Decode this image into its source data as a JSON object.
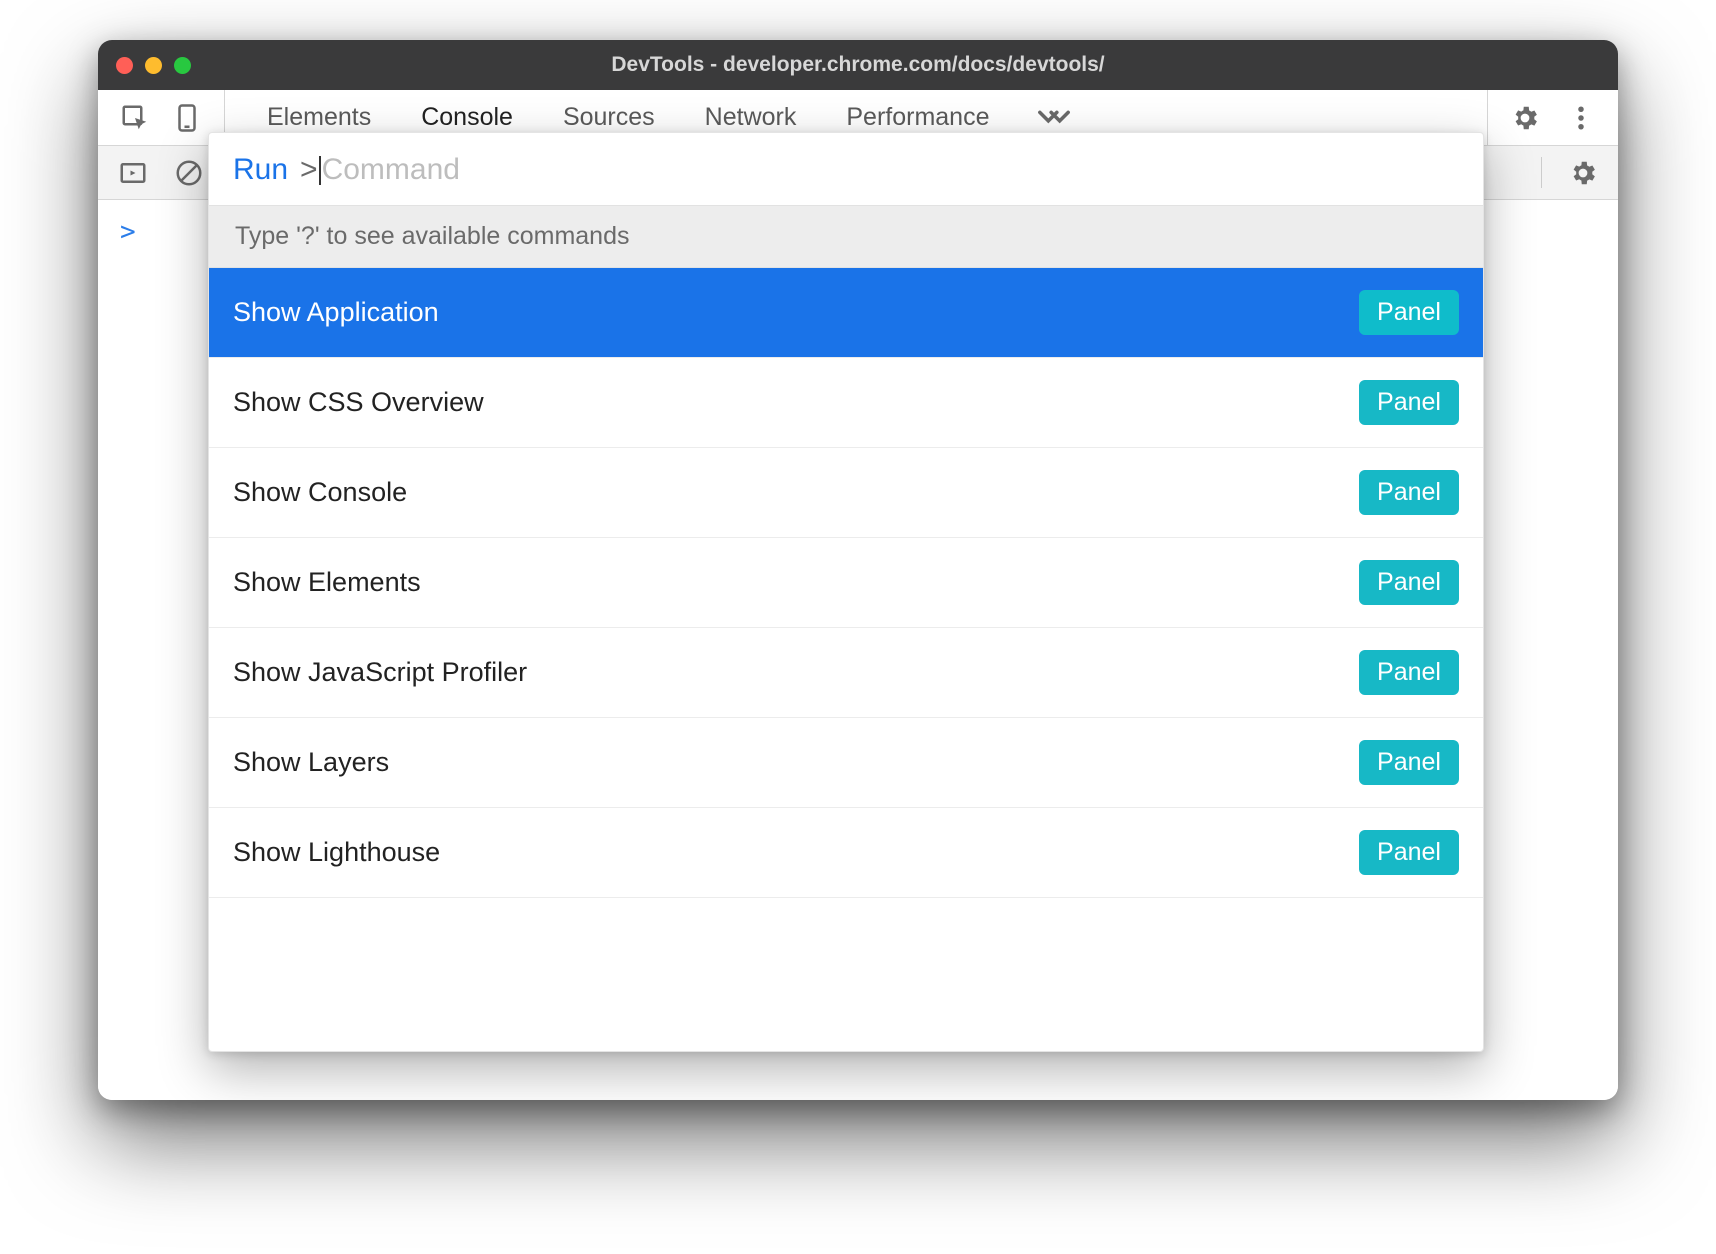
{
  "titlebar": {
    "title": "DevTools - developer.chrome.com/docs/devtools/"
  },
  "toolbar": {
    "tabs": [
      "Elements",
      "Console",
      "Sources",
      "Network",
      "Performance"
    ],
    "active_tab": "Console"
  },
  "console": {
    "prompt": ">"
  },
  "command_menu": {
    "prefix": "Run",
    "caret": ">",
    "placeholder": "Command",
    "hint": "Type '?' to see available commands",
    "badge_label": "Panel",
    "items": [
      {
        "label": "Show Application",
        "selected": true
      },
      {
        "label": "Show CSS Overview",
        "selected": false
      },
      {
        "label": "Show Console",
        "selected": false
      },
      {
        "label": "Show Elements",
        "selected": false
      },
      {
        "label": "Show JavaScript Profiler",
        "selected": false
      },
      {
        "label": "Show Layers",
        "selected": false
      },
      {
        "label": "Show Lighthouse",
        "selected": false
      }
    ]
  }
}
